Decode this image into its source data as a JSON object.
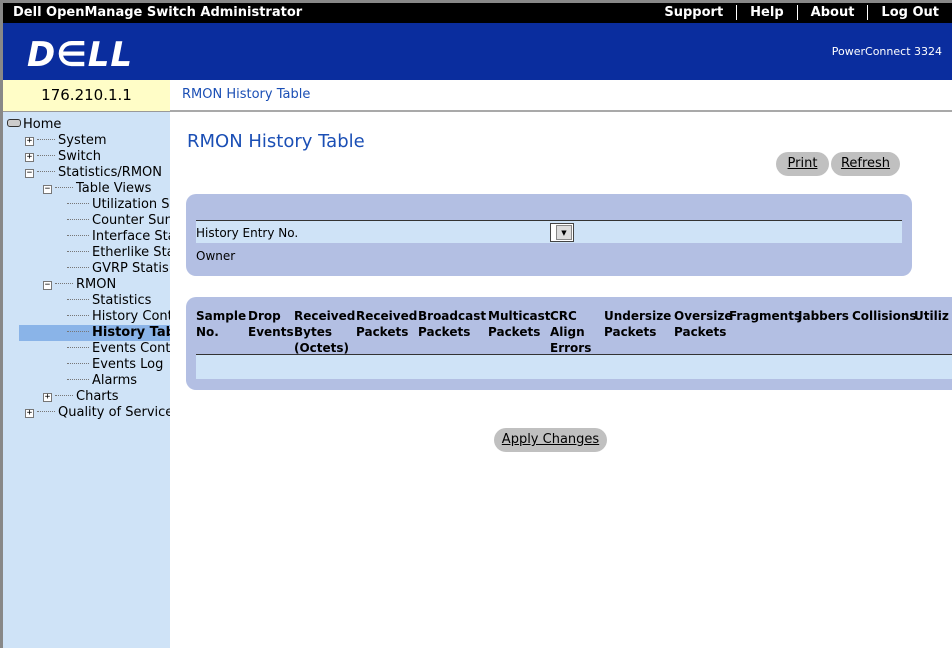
{
  "app": {
    "title": "Dell OpenManage Switch Administrator",
    "links": [
      "Support",
      "Help",
      "About",
      "Log Out"
    ],
    "logo": "D∈LL",
    "product": "PowerConnect 3324",
    "ip": "176.210.1.1",
    "breadcrumb": "RMON History Table"
  },
  "sidebar": {
    "items": [
      {
        "label": "Home"
      },
      {
        "label": "System"
      },
      {
        "label": "Switch"
      },
      {
        "label": "Statistics/RMON"
      },
      {
        "label": "Table Views"
      },
      {
        "label": "Utilization Su"
      },
      {
        "label": "Counter Sum"
      },
      {
        "label": "Interface Stat"
      },
      {
        "label": "Etherlike Sta"
      },
      {
        "label": "GVRP Statis"
      },
      {
        "label": "RMON"
      },
      {
        "label": "Statistics"
      },
      {
        "label": "History Contr"
      },
      {
        "label": "History Tabl"
      },
      {
        "label": "Events Contr"
      },
      {
        "label": "Events Log"
      },
      {
        "label": "Alarms"
      },
      {
        "label": "Charts"
      },
      {
        "label": "Quality of Service"
      }
    ]
  },
  "main": {
    "title": "RMON History Table",
    "print": "Print",
    "refresh": "Refresh",
    "history_entry_label": "History Entry No.",
    "owner_label": "Owner",
    "apply": "Apply Changes",
    "columns": [
      "Sample\nNo.",
      "Drop\nEvents",
      "Received\nBytes\n(Octets)",
      "Received\nPackets",
      "Broadcast\nPackets",
      "Multicast\nPackets",
      "CRC\nAlign\nErrors",
      "Undersize\nPackets",
      "Oversize\nPackets",
      "Fragments",
      "Jabbers",
      "Collisions",
      "Utiliz"
    ]
  }
}
